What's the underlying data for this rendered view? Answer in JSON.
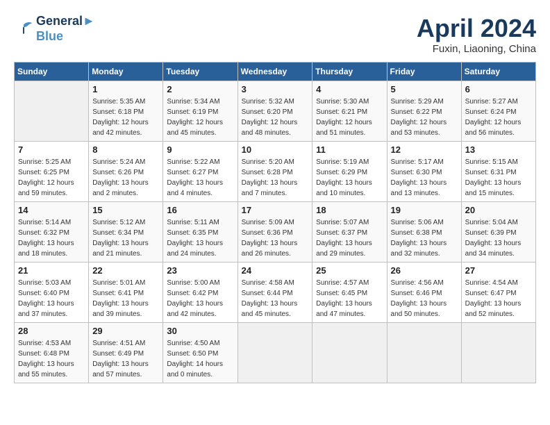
{
  "header": {
    "logo_line1": "General",
    "logo_line2": "Blue",
    "month_title": "April 2024",
    "location": "Fuxin, Liaoning, China"
  },
  "weekdays": [
    "Sunday",
    "Monday",
    "Tuesday",
    "Wednesday",
    "Thursday",
    "Friday",
    "Saturday"
  ],
  "weeks": [
    [
      {
        "day": "",
        "sunrise": "",
        "sunset": "",
        "daylight": ""
      },
      {
        "day": "1",
        "sunrise": "Sunrise: 5:35 AM",
        "sunset": "Sunset: 6:18 PM",
        "daylight": "Daylight: 12 hours and 42 minutes."
      },
      {
        "day": "2",
        "sunrise": "Sunrise: 5:34 AM",
        "sunset": "Sunset: 6:19 PM",
        "daylight": "Daylight: 12 hours and 45 minutes."
      },
      {
        "day": "3",
        "sunrise": "Sunrise: 5:32 AM",
        "sunset": "Sunset: 6:20 PM",
        "daylight": "Daylight: 12 hours and 48 minutes."
      },
      {
        "day": "4",
        "sunrise": "Sunrise: 5:30 AM",
        "sunset": "Sunset: 6:21 PM",
        "daylight": "Daylight: 12 hours and 51 minutes."
      },
      {
        "day": "5",
        "sunrise": "Sunrise: 5:29 AM",
        "sunset": "Sunset: 6:22 PM",
        "daylight": "Daylight: 12 hours and 53 minutes."
      },
      {
        "day": "6",
        "sunrise": "Sunrise: 5:27 AM",
        "sunset": "Sunset: 6:24 PM",
        "daylight": "Daylight: 12 hours and 56 minutes."
      }
    ],
    [
      {
        "day": "7",
        "sunrise": "Sunrise: 5:25 AM",
        "sunset": "Sunset: 6:25 PM",
        "daylight": "Daylight: 12 hours and 59 minutes."
      },
      {
        "day": "8",
        "sunrise": "Sunrise: 5:24 AM",
        "sunset": "Sunset: 6:26 PM",
        "daylight": "Daylight: 13 hours and 2 minutes."
      },
      {
        "day": "9",
        "sunrise": "Sunrise: 5:22 AM",
        "sunset": "Sunset: 6:27 PM",
        "daylight": "Daylight: 13 hours and 4 minutes."
      },
      {
        "day": "10",
        "sunrise": "Sunrise: 5:20 AM",
        "sunset": "Sunset: 6:28 PM",
        "daylight": "Daylight: 13 hours and 7 minutes."
      },
      {
        "day": "11",
        "sunrise": "Sunrise: 5:19 AM",
        "sunset": "Sunset: 6:29 PM",
        "daylight": "Daylight: 13 hours and 10 minutes."
      },
      {
        "day": "12",
        "sunrise": "Sunrise: 5:17 AM",
        "sunset": "Sunset: 6:30 PM",
        "daylight": "Daylight: 13 hours and 13 minutes."
      },
      {
        "day": "13",
        "sunrise": "Sunrise: 5:15 AM",
        "sunset": "Sunset: 6:31 PM",
        "daylight": "Daylight: 13 hours and 15 minutes."
      }
    ],
    [
      {
        "day": "14",
        "sunrise": "Sunrise: 5:14 AM",
        "sunset": "Sunset: 6:32 PM",
        "daylight": "Daylight: 13 hours and 18 minutes."
      },
      {
        "day": "15",
        "sunrise": "Sunrise: 5:12 AM",
        "sunset": "Sunset: 6:34 PM",
        "daylight": "Daylight: 13 hours and 21 minutes."
      },
      {
        "day": "16",
        "sunrise": "Sunrise: 5:11 AM",
        "sunset": "Sunset: 6:35 PM",
        "daylight": "Daylight: 13 hours and 24 minutes."
      },
      {
        "day": "17",
        "sunrise": "Sunrise: 5:09 AM",
        "sunset": "Sunset: 6:36 PM",
        "daylight": "Daylight: 13 hours and 26 minutes."
      },
      {
        "day": "18",
        "sunrise": "Sunrise: 5:07 AM",
        "sunset": "Sunset: 6:37 PM",
        "daylight": "Daylight: 13 hours and 29 minutes."
      },
      {
        "day": "19",
        "sunrise": "Sunrise: 5:06 AM",
        "sunset": "Sunset: 6:38 PM",
        "daylight": "Daylight: 13 hours and 32 minutes."
      },
      {
        "day": "20",
        "sunrise": "Sunrise: 5:04 AM",
        "sunset": "Sunset: 6:39 PM",
        "daylight": "Daylight: 13 hours and 34 minutes."
      }
    ],
    [
      {
        "day": "21",
        "sunrise": "Sunrise: 5:03 AM",
        "sunset": "Sunset: 6:40 PM",
        "daylight": "Daylight: 13 hours and 37 minutes."
      },
      {
        "day": "22",
        "sunrise": "Sunrise: 5:01 AM",
        "sunset": "Sunset: 6:41 PM",
        "daylight": "Daylight: 13 hours and 39 minutes."
      },
      {
        "day": "23",
        "sunrise": "Sunrise: 5:00 AM",
        "sunset": "Sunset: 6:42 PM",
        "daylight": "Daylight: 13 hours and 42 minutes."
      },
      {
        "day": "24",
        "sunrise": "Sunrise: 4:58 AM",
        "sunset": "Sunset: 6:44 PM",
        "daylight": "Daylight: 13 hours and 45 minutes."
      },
      {
        "day": "25",
        "sunrise": "Sunrise: 4:57 AM",
        "sunset": "Sunset: 6:45 PM",
        "daylight": "Daylight: 13 hours and 47 minutes."
      },
      {
        "day": "26",
        "sunrise": "Sunrise: 4:56 AM",
        "sunset": "Sunset: 6:46 PM",
        "daylight": "Daylight: 13 hours and 50 minutes."
      },
      {
        "day": "27",
        "sunrise": "Sunrise: 4:54 AM",
        "sunset": "Sunset: 6:47 PM",
        "daylight": "Daylight: 13 hours and 52 minutes."
      }
    ],
    [
      {
        "day": "28",
        "sunrise": "Sunrise: 4:53 AM",
        "sunset": "Sunset: 6:48 PM",
        "daylight": "Daylight: 13 hours and 55 minutes."
      },
      {
        "day": "29",
        "sunrise": "Sunrise: 4:51 AM",
        "sunset": "Sunset: 6:49 PM",
        "daylight": "Daylight: 13 hours and 57 minutes."
      },
      {
        "day": "30",
        "sunrise": "Sunrise: 4:50 AM",
        "sunset": "Sunset: 6:50 PM",
        "daylight": "Daylight: 14 hours and 0 minutes."
      },
      {
        "day": "",
        "sunrise": "",
        "sunset": "",
        "daylight": ""
      },
      {
        "day": "",
        "sunrise": "",
        "sunset": "",
        "daylight": ""
      },
      {
        "day": "",
        "sunrise": "",
        "sunset": "",
        "daylight": ""
      },
      {
        "day": "",
        "sunrise": "",
        "sunset": "",
        "daylight": ""
      }
    ]
  ]
}
